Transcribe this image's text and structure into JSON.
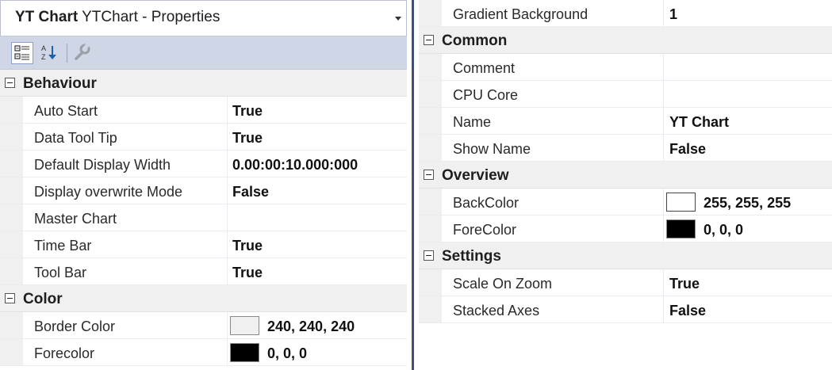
{
  "left": {
    "title_bold": "YT Chart",
    "title_rest": "YTChart - Properties",
    "toolbar": {
      "icons": [
        "categorized-icon",
        "alphabetical-icon",
        "property-pages-icon"
      ]
    },
    "behaviour": {
      "label": "Behaviour",
      "rows": [
        {
          "name": "Auto Start",
          "value": "True"
        },
        {
          "name": "Data Tool Tip",
          "value": "True"
        },
        {
          "name": "Default Display Width",
          "value": "0.00:00:10.000:000"
        },
        {
          "name": "Display overwrite Mode",
          "value": "False"
        },
        {
          "name": "Master Chart",
          "value": ""
        },
        {
          "name": "Time Bar",
          "value": "True"
        },
        {
          "name": "Tool Bar",
          "value": "True"
        }
      ]
    },
    "color": {
      "label": "Color",
      "rows": [
        {
          "name": "Border Color",
          "value": "240, 240, 240",
          "swatch": "#f0f0f0"
        },
        {
          "name": "Forecolor",
          "value": "0, 0, 0",
          "swatch": "#000000"
        }
      ]
    }
  },
  "right": {
    "top_row": {
      "name": "Gradient Background",
      "value": "1"
    },
    "common": {
      "label": "Common",
      "rows": [
        {
          "name": "Comment",
          "value": ""
        },
        {
          "name": "CPU Core",
          "value": ""
        },
        {
          "name": "Name",
          "value": "YT Chart"
        },
        {
          "name": "Show Name",
          "value": "False"
        }
      ]
    },
    "overview": {
      "label": "Overview",
      "rows": [
        {
          "name": "BackColor",
          "value": "255, 255, 255",
          "swatch": "#ffffff"
        },
        {
          "name": "ForeColor",
          "value": "0, 0, 0",
          "swatch": "#000000"
        }
      ]
    },
    "settings": {
      "label": "Settings",
      "rows": [
        {
          "name": "Scale On Zoom",
          "value": "True"
        },
        {
          "name": "Stacked Axes",
          "value": "False"
        }
      ]
    }
  }
}
